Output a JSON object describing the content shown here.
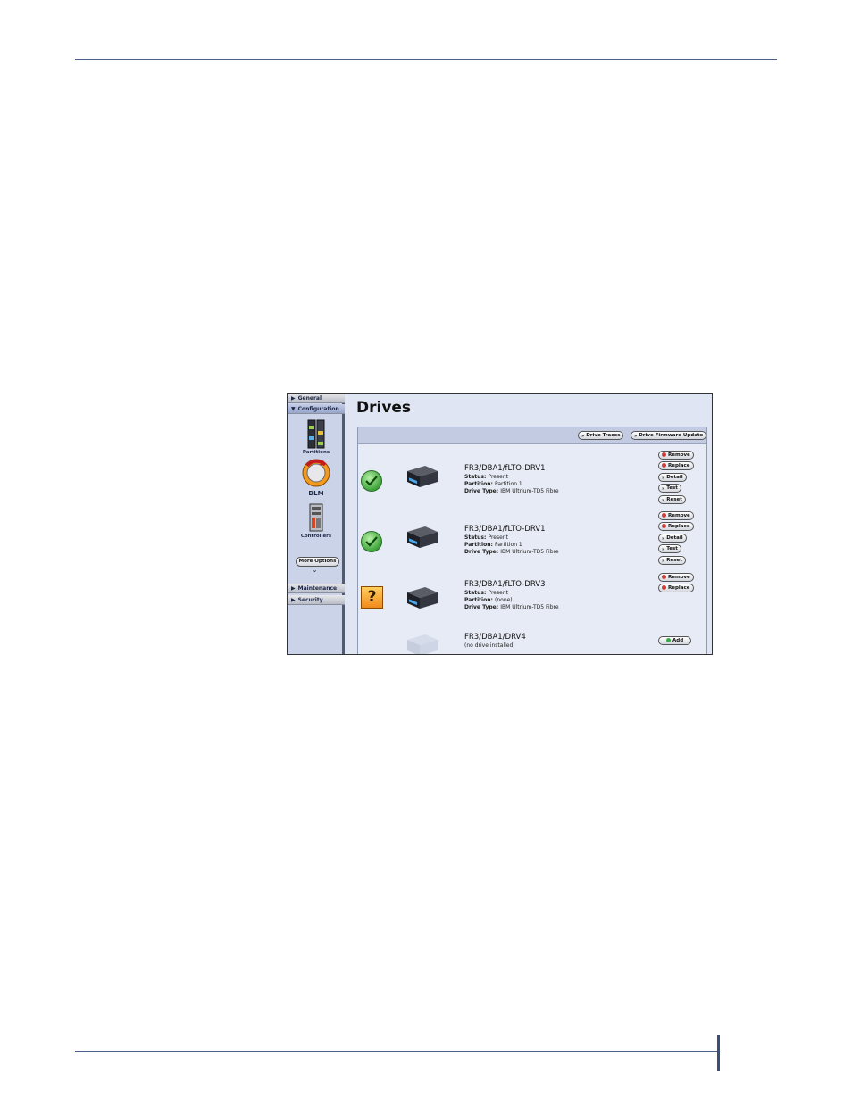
{
  "sidebar": {
    "sections": [
      {
        "label": "General",
        "expanded": false
      },
      {
        "label": "Configuration",
        "expanded": true
      },
      {
        "label": "Maintenance",
        "expanded": false
      },
      {
        "label": "Security",
        "expanded": false
      }
    ],
    "items": [
      {
        "label": "Partitions",
        "icon": "partitions-icon"
      },
      {
        "label": "DLM",
        "icon": "dlm-icon"
      },
      {
        "label": "Controllers",
        "icon": "controllers-icon"
      }
    ],
    "more_options": "More Options"
  },
  "main": {
    "title": "Drives",
    "toolbar": {
      "drive_traces": "Drive Traces",
      "firmware_update": "Drive Firmware Update"
    },
    "labels": {
      "status": "Status",
      "partition": "Partition",
      "drive_type": "Drive Type"
    },
    "drives": [
      {
        "name": "FR3/DBA1/fLTO-DRV1",
        "status": "Present",
        "partition": "Partition 1",
        "drive_type": "IBM Ultrium-TD5 Fibre",
        "state_icon": "check-icon",
        "actions": [
          "Remove",
          "Replace",
          "Detail",
          "Test",
          "Reset"
        ]
      },
      {
        "name": "FR3/DBA1/fLTO-DRV1",
        "status": "Present",
        "partition": "Partition 1",
        "drive_type": "IBM Ultrium-TD5 Fibre",
        "state_icon": "check-icon",
        "actions": [
          "Remove",
          "Replace",
          "Detail",
          "Test",
          "Reset"
        ]
      },
      {
        "name": "FR3/DBA1/fLTO-DRV3",
        "status": "Present",
        "partition": "(none)",
        "drive_type": "IBM Ultrium-TD5 Fibre",
        "state_icon": "question-icon",
        "actions": [
          "Remove",
          "Replace"
        ]
      },
      {
        "name": "FR3/DBA1/DRV4",
        "note": "(no drive installed)",
        "actions": [
          "Add"
        ]
      }
    ]
  },
  "colors": {
    "accent_rule": "#4a5f8a",
    "sidebar_bg": "#cbd3e8",
    "panel_bg": "#e6ebf5",
    "remove_icon": "#d23a3a",
    "add_icon": "#39a94a"
  }
}
